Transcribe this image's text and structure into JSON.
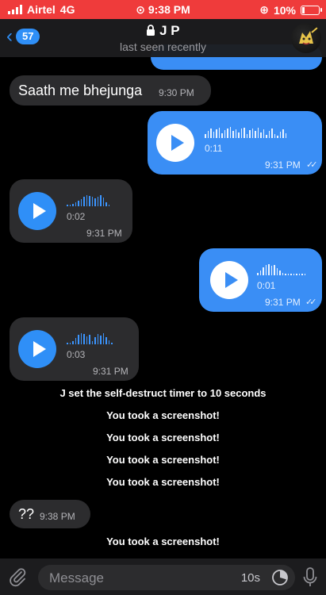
{
  "status_bar": {
    "carrier": "Airtel",
    "network": "4G",
    "time": "9:38 PM",
    "battery": "10%"
  },
  "header": {
    "back_count": "57",
    "contact_name": "J P",
    "status": "last seen recently"
  },
  "messages": [
    {
      "type": "text",
      "direction": "in",
      "text": "Saath me bhejunga",
      "time": "9:30 PM"
    },
    {
      "type": "voice",
      "direction": "out",
      "duration": "0:11",
      "time": "9:31 PM"
    },
    {
      "type": "voice",
      "direction": "in",
      "duration": "0:02",
      "time": "9:31 PM"
    },
    {
      "type": "voice",
      "direction": "out",
      "duration": "0:01",
      "time": "9:31 PM"
    },
    {
      "type": "voice",
      "direction": "in",
      "duration": "0:03",
      "time": "9:31 PM"
    },
    {
      "type": "service",
      "text": "J set the self-destruct timer to 10 seconds"
    },
    {
      "type": "service",
      "text": "You took a screenshot!"
    },
    {
      "type": "service",
      "text": "You took a screenshot!"
    },
    {
      "type": "service",
      "text": "You took a screenshot!"
    },
    {
      "type": "service",
      "text": "You took a screenshot!"
    },
    {
      "type": "text",
      "direction": "in",
      "text": "??",
      "time": "9:38 PM"
    },
    {
      "type": "service",
      "text": "You took a screenshot!"
    }
  ],
  "input": {
    "placeholder": "Message",
    "timer": "10s"
  },
  "colors": {
    "accent": "#2f8ff7",
    "outgoing_bubble": "#3a8ef5",
    "incoming_bubble": "#2c2c2e",
    "status_bar": "#ef3b3b"
  }
}
